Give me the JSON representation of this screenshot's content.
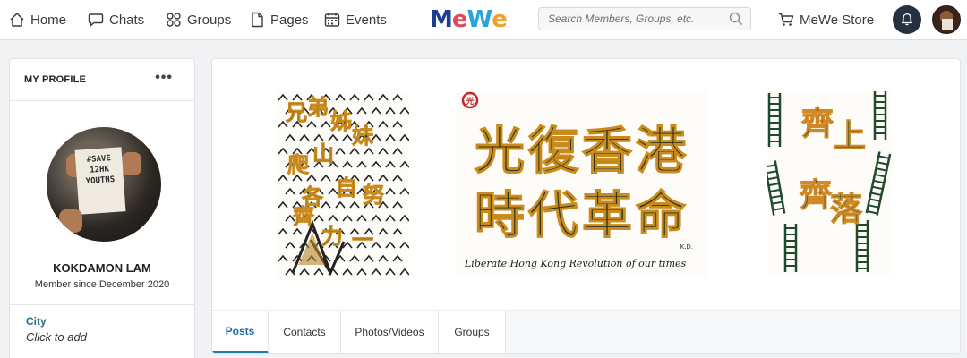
{
  "nav": {
    "home": "Home",
    "chats": "Chats",
    "groups": "Groups",
    "pages": "Pages",
    "events": "Events",
    "store": "MeWe Store",
    "search_placeholder": "Search Members, Groups, etc."
  },
  "logo": {
    "text_m": "M",
    "text_e1": "e",
    "text_w": "W",
    "text_e2": "e"
  },
  "profile": {
    "section_title": "MY PROFILE",
    "more": "•••",
    "name": "KOKDAMON LAM",
    "member_since": "Member since December 2020",
    "city_label": "City",
    "city_value": "Click to add",
    "photo_sign": "#SAVE 12HK YOUTHS"
  },
  "cover": {
    "art1_text": [
      "兄",
      "弟",
      "姊",
      "妹",
      "爬",
      "山",
      "各",
      "自",
      "努",
      "力",
      "一",
      "齊"
    ],
    "art2_line1": "光復香港",
    "art2_line2": "時代革命",
    "art2_caption": "Liberate Hong Kong  Revolution of our times",
    "art2_sig": "K.D.",
    "art3_text": [
      "齊",
      "上",
      "齊",
      "落"
    ]
  },
  "tabs": [
    {
      "label": "Posts",
      "active": true
    },
    {
      "label": "Contacts",
      "active": false
    },
    {
      "label": "Photos/Videos",
      "active": false
    },
    {
      "label": "Groups",
      "active": false
    }
  ],
  "colors": {
    "accent": "#1f7ab0",
    "city_label": "#2a6a8a",
    "bell_bg": "#253041"
  }
}
